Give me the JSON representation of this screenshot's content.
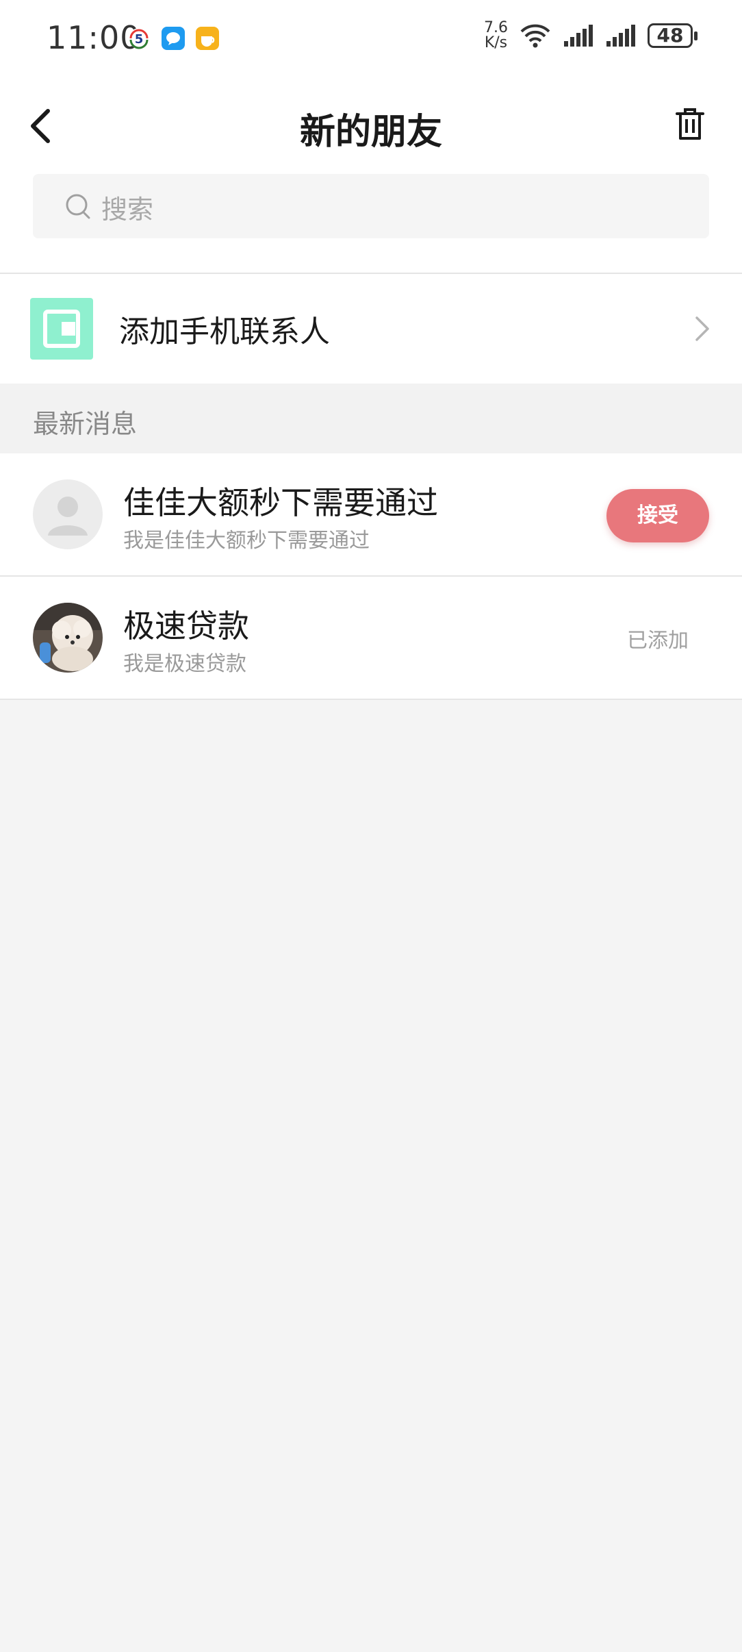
{
  "status_bar": {
    "time": "11:00",
    "net_speed_value": "7.6",
    "net_speed_unit": "K/s",
    "battery": "48"
  },
  "header": {
    "title": "新的朋友"
  },
  "search": {
    "placeholder": "搜索"
  },
  "add_contacts": {
    "label": "添加手机联系人"
  },
  "section": {
    "label": "最新消息"
  },
  "friends": [
    {
      "name": "佳佳大额秒下需要通过",
      "message": "我是佳佳大额秒下需要通过",
      "action": "接受"
    },
    {
      "name": "极速贷款",
      "message": "我是极速贷款",
      "status": "已添加"
    }
  ],
  "colors": {
    "accent": "#e8777c",
    "contacts_icon_bg": "#8ff0cf",
    "page_bg": "#f4f4f4"
  }
}
